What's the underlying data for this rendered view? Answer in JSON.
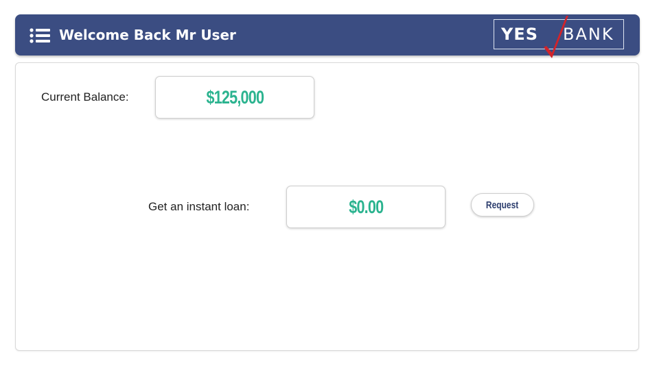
{
  "header": {
    "title": "Welcome Back Mr User",
    "menu_icon": "list-menu-icon",
    "background_color": "#3b4d82"
  },
  "logo": {
    "left_text": "YES",
    "right_text": "BANK",
    "mark_color": "#d2232a"
  },
  "balance": {
    "label": "Current Balance:",
    "value": "$125,000"
  },
  "loan": {
    "label": "Get an instant loan:",
    "value": "$0.00",
    "button_label": "Request"
  },
  "colors": {
    "accent_value": "#2bb38f",
    "button_text": "#2d3e6e"
  }
}
